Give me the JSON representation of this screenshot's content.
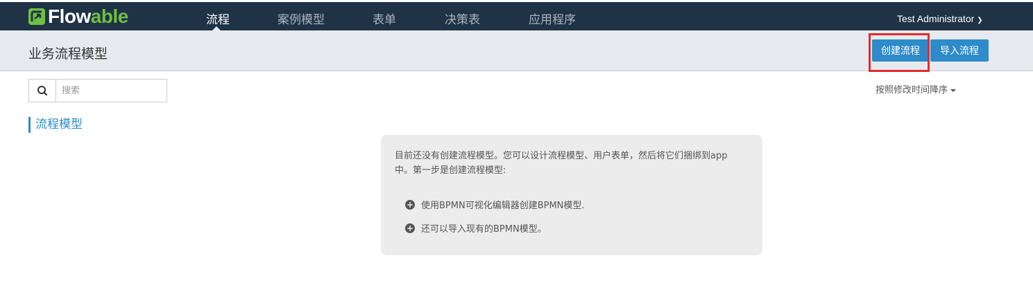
{
  "header": {
    "logo": {
      "text_main": "Flow",
      "text_accent": "able",
      "brand_color": "#6fbf40"
    },
    "nav": [
      {
        "label": "流程",
        "active": true
      },
      {
        "label": "案例模型",
        "active": false
      },
      {
        "label": "表单",
        "active": false
      },
      {
        "label": "决策表",
        "active": false
      },
      {
        "label": "应用程序",
        "active": false
      }
    ],
    "user": "Test Administrator",
    "user_icon": "chevron-down-icon"
  },
  "subheader": {
    "title": "业务流程模型",
    "create_button": "创建流程",
    "import_button": "导入流程"
  },
  "toolbar": {
    "search_placeholder": "搜索",
    "search_icon": "search-icon",
    "sort_label": "按照修改时间降序"
  },
  "sidebar": {
    "section_label": "流程模型"
  },
  "empty_state": {
    "message": "目前还没有创建流程模型。您可以设计流程模型、用户表单，然后将它们捆绑到app中。第一步是创建流程模型:",
    "tips": [
      "使用BPMN可视化编辑器创建BPMN模型.",
      "还可以导入现有的BPMN模型。"
    ]
  },
  "colors": {
    "topbar": "#1f3246",
    "accent": "#2e8bc9",
    "highlight": "#e32a2a"
  }
}
